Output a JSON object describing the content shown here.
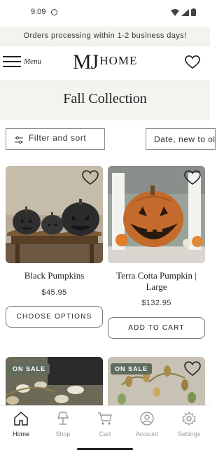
{
  "status_bar": {
    "time": "9:09"
  },
  "announcement": {
    "text": "Orders processing within 1-2 business days!"
  },
  "header": {
    "menu_label": "Menu",
    "logo_mj": "MJ",
    "logo_home": "HOME"
  },
  "collection": {
    "title": "Fall Collection"
  },
  "filters": {
    "filter_label": "Filter and sort",
    "sort_label": "Date, new to old"
  },
  "products": [
    {
      "title": "Black Pumpkins",
      "price": "$45.95",
      "button": "CHOOSE OPTIONS"
    },
    {
      "title": "Terra Cotta Pumpkin | Large",
      "price": "$132.95",
      "button": "ADD TO CART"
    },
    {
      "badge": "ON SALE"
    },
    {
      "badge": "ON SALE"
    }
  ],
  "bottom_nav": {
    "items": [
      {
        "label": "Home",
        "icon": "home-icon",
        "active": true
      },
      {
        "label": "Shop",
        "icon": "lamp-icon",
        "active": false
      },
      {
        "label": "Cart",
        "icon": "cart-icon",
        "active": false
      },
      {
        "label": "Account",
        "icon": "account-icon",
        "active": false
      },
      {
        "label": "Settings",
        "icon": "settings-icon",
        "active": false
      }
    ]
  },
  "colors": {
    "accent": "#5e6b5e",
    "banner_bg": "#f4f3f0",
    "text": "#222222"
  }
}
